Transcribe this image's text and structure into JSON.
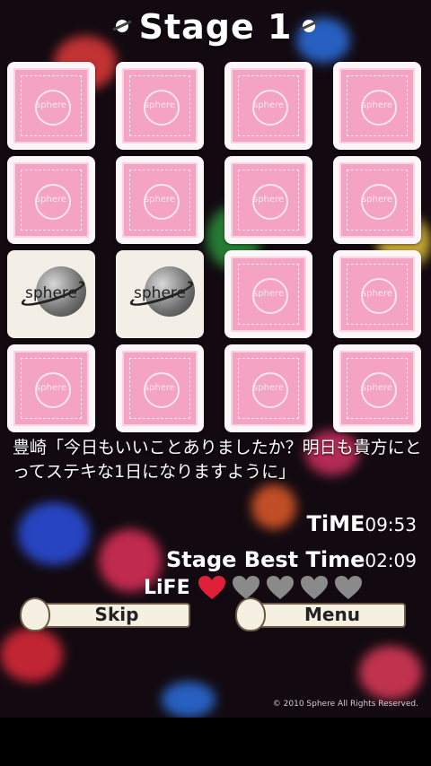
{
  "header": {
    "title": "Stage 1"
  },
  "board": {
    "cards": [
      {
        "state": "face-down",
        "label": "sphere"
      },
      {
        "state": "face-down",
        "label": "sphere"
      },
      {
        "state": "face-down",
        "label": "sphere"
      },
      {
        "state": "face-down",
        "label": "sphere"
      },
      {
        "state": "face-down",
        "label": "sphere"
      },
      {
        "state": "face-down",
        "label": "sphere"
      },
      {
        "state": "face-down",
        "label": "sphere"
      },
      {
        "state": "face-down",
        "label": "sphere"
      },
      {
        "state": "open",
        "label": "sphere"
      },
      {
        "state": "open",
        "label": "sphere"
      },
      {
        "state": "face-down",
        "label": "sphere"
      },
      {
        "state": "face-down",
        "label": "sphere"
      },
      {
        "state": "face-down",
        "label": "sphere"
      },
      {
        "state": "face-down",
        "label": "sphere"
      },
      {
        "state": "face-down",
        "label": "sphere"
      },
      {
        "state": "face-down",
        "label": "sphere"
      }
    ]
  },
  "message": {
    "text": "豊崎「今日もいいことありましたか？明日も貴方にとってステキな1日になりますように」"
  },
  "stats": {
    "time_label": "TiME",
    "time_value": "09:53",
    "best_label": "Stage Best Time",
    "best_value": "02:09",
    "life_label": "LiFE",
    "life_total": 5,
    "life_remaining": 1
  },
  "controls": {
    "skip_label": "Skip",
    "menu_label": "Menu"
  },
  "footer": {
    "copyright": "© 2010 Sphere All Rights Reserved."
  },
  "colors": {
    "card_back": "#f4a3c3",
    "heart_full": "#e0203a",
    "heart_empty": "#8a8a8a"
  }
}
